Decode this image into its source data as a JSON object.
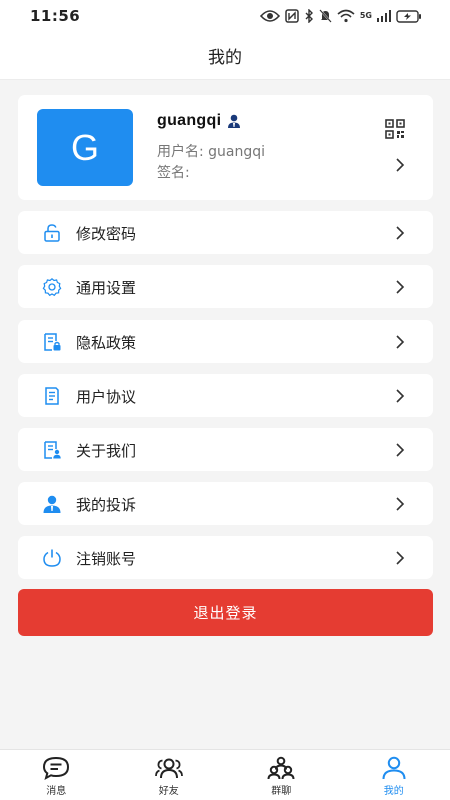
{
  "status_bar": {
    "time": "11:56",
    "network_label": "5G"
  },
  "header": {
    "title": "我的"
  },
  "profile": {
    "avatar_letter": "G",
    "name": "guangqi",
    "username_line": "用户名: guangqi",
    "signature_line": "签名:",
    "avatar_color": "#1f8df0"
  },
  "menu": {
    "items": [
      {
        "label": "修改密码",
        "icon": "lock-icon"
      },
      {
        "label": "通用设置",
        "icon": "gear-icon"
      },
      {
        "label": "隐私政策",
        "icon": "document-lock-icon"
      },
      {
        "label": "用户协议",
        "icon": "document-icon"
      },
      {
        "label": "关于我们",
        "icon": "document-person-icon"
      },
      {
        "label": "我的投诉",
        "icon": "person-icon"
      },
      {
        "label": "注销账号",
        "icon": "power-icon"
      }
    ]
  },
  "logout": {
    "label": "退出登录",
    "color": "#e53c32"
  },
  "bottom_nav": {
    "items": [
      {
        "label": "消息",
        "icon": "message-icon"
      },
      {
        "label": "好友",
        "icon": "friends-icon"
      },
      {
        "label": "群聊",
        "icon": "group-icon"
      },
      {
        "label": "我的",
        "icon": "profile-icon",
        "active": true
      }
    ],
    "accent_color": "#1f8df0"
  }
}
